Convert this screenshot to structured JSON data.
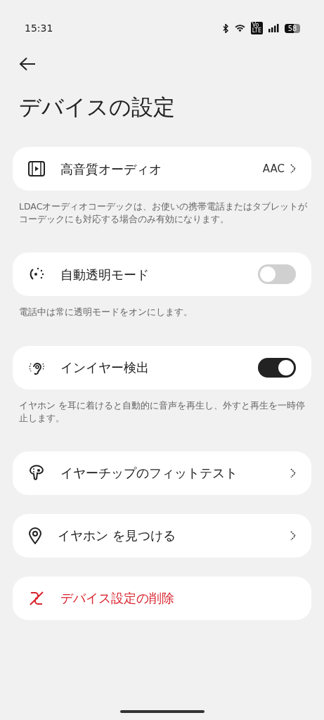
{
  "status_bar": {
    "time": "15:31",
    "volte_top": "Vo",
    "volte_bottom": "LTE",
    "battery": "58"
  },
  "title": "デバイスの設定",
  "items": [
    {
      "kind": "link",
      "label": "高音質オーディオ",
      "value": "AAC",
      "note": "LDACオーディオコーデックは、お使いの携帯電話またはタブレットがコーデックにも対応する場合のみ有効になります。"
    },
    {
      "kind": "toggle",
      "label": "自動透明モード",
      "on": false,
      "note": "電話中は常に透明モードをオンにします。"
    },
    {
      "kind": "toggle",
      "label": "インイヤー検出",
      "on": true,
      "note": "イヤホン を耳に着けると自動的に音声を再生し、外すと再生を一時停止します。"
    },
    {
      "kind": "link",
      "label": "イヤーチップのフィットテスト"
    },
    {
      "kind": "link",
      "label": "イヤホン を見つける"
    },
    {
      "kind": "danger",
      "label": "デバイス設定の削除"
    }
  ]
}
